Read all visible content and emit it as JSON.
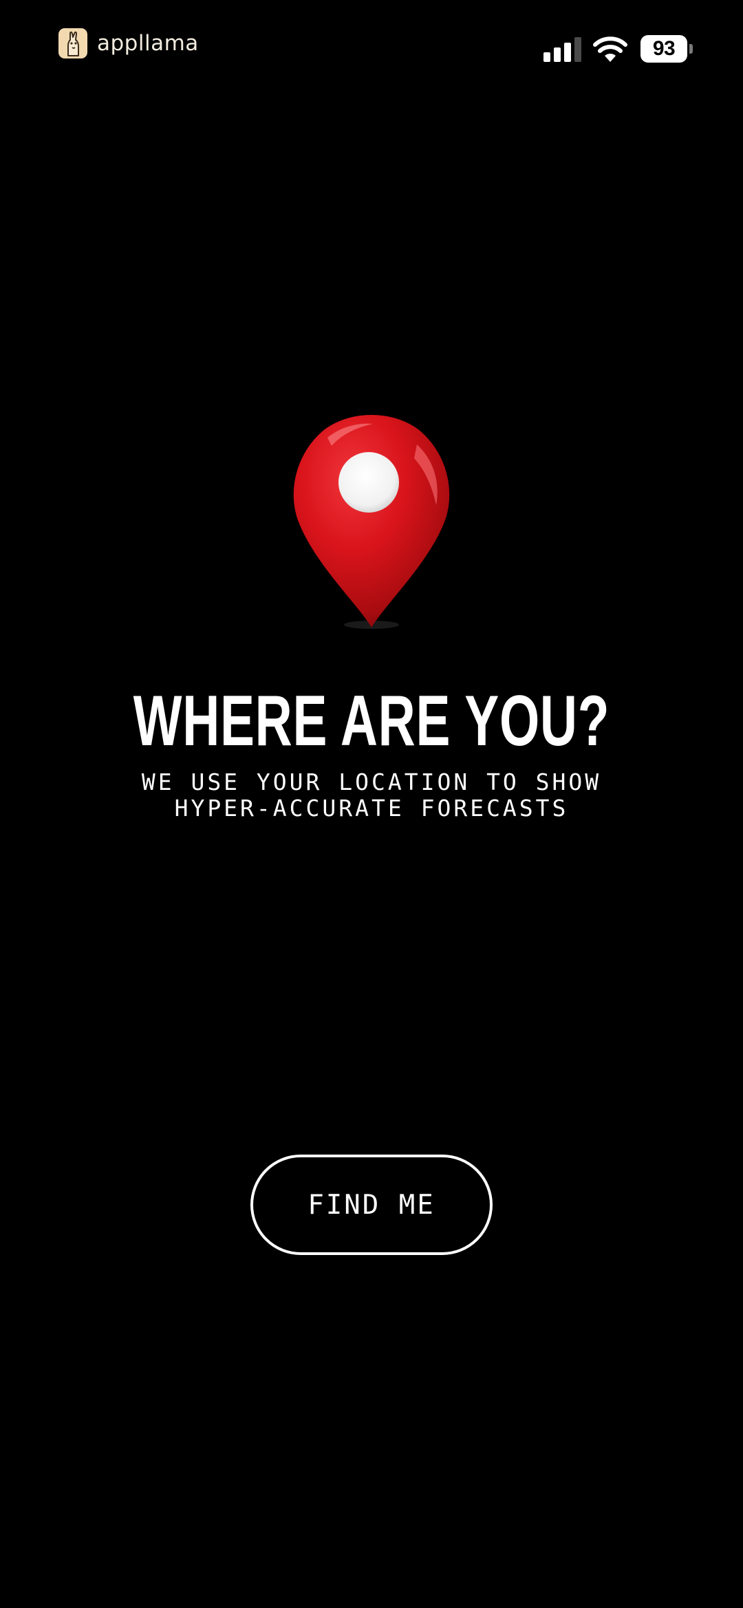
{
  "status_bar": {
    "brand_name": "appllama",
    "brand_logo_icon": "llama-logo-icon",
    "signal_icon": "cellular-signal-icon",
    "wifi_icon": "wifi-icon",
    "battery_level": "93"
  },
  "main": {
    "pin_icon": "location-pin-icon",
    "headline": "WHERE ARE YOU?",
    "subtitle": "WE USE YOUR LOCATION TO SHOW HYPER-ACCURATE FORECASTS"
  },
  "actions": {
    "find_me_label": "FIND ME"
  },
  "colors": {
    "background": "#000000",
    "text": "#ffffff",
    "pin_red": "#d9141b",
    "brand_logo_bg": "#f2d9b0"
  }
}
